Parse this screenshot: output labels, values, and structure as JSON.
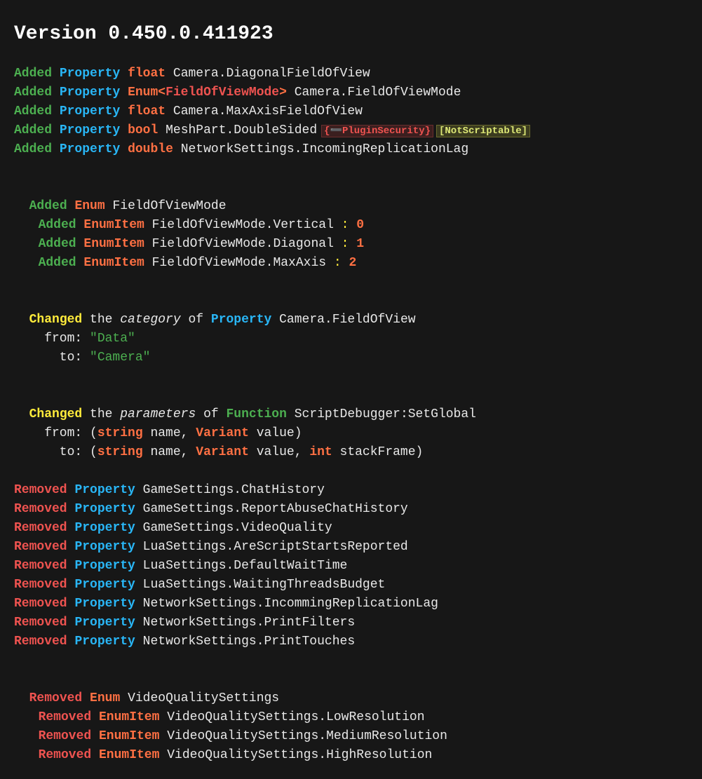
{
  "title": "Version 0.450.0.411923",
  "addedProps": [
    {
      "action": "Added",
      "kind": "Property",
      "type": "float",
      "name": "Camera.DiagonalFieldOfView"
    },
    {
      "action": "Added",
      "kind": "Property",
      "typePrefix": "Enum<",
      "typeInner": "FieldOfViewMode",
      "typeSuffix": ">",
      "name": "Camera.FieldOfViewMode"
    },
    {
      "action": "Added",
      "kind": "Property",
      "type": "float",
      "name": "Camera.MaxAxisFieldOfView"
    },
    {
      "action": "Added",
      "kind": "Property",
      "type": "bool",
      "name": "MeshPart.DoubleSided",
      "tagRed": "{➖PluginSecurity}",
      "tagYellow": "[NotScriptable]"
    },
    {
      "action": "Added",
      "kind": "Property",
      "type": "double",
      "name": "NetworkSettings.IncomingReplicationLag"
    }
  ],
  "addedEnum": {
    "action": "Added",
    "kind": "Enum",
    "name": "FieldOfViewMode",
    "items": [
      {
        "action": "Added",
        "kind": "EnumItem",
        "name": "FieldOfViewMode.Vertical",
        "sep": " : ",
        "value": "0"
      },
      {
        "action": "Added",
        "kind": "EnumItem",
        "name": "FieldOfViewMode.Diagonal",
        "sep": " : ",
        "value": "1"
      },
      {
        "action": "Added",
        "kind": "EnumItem",
        "name": "FieldOfViewMode.MaxAxis",
        "sep": " : ",
        "value": "2"
      }
    ]
  },
  "change1": {
    "action": "Changed",
    "the": " the ",
    "what": "category",
    "of": " of ",
    "kind": "Property",
    "name": " Camera.FieldOfView",
    "fromLabel": "from: ",
    "fromVal": "\"Data\"",
    "toLabel": "to: ",
    "toVal": "\"Camera\""
  },
  "change2": {
    "action": "Changed",
    "the": " the ",
    "what": "parameters",
    "of": " of ",
    "kind": "Function",
    "name": " ScriptDebugger:SetGlobal",
    "fromLabel": "from: ",
    "fromOpen": "(",
    "fromT1": "string",
    "fromN1": " name, ",
    "fromT2": "Variant",
    "fromN2": " value",
    "fromClose": ")",
    "toLabel": "to: ",
    "toOpen": "(",
    "toT1": "string",
    "toN1": " name, ",
    "toT2": "Variant",
    "toN2": " value, ",
    "toT3": "int",
    "toN3": " stackFrame",
    "toClose": ")"
  },
  "removedProps": [
    {
      "action": "Removed",
      "kind": "Property",
      "name": "GameSettings.ChatHistory"
    },
    {
      "action": "Removed",
      "kind": "Property",
      "name": "GameSettings.ReportAbuseChatHistory"
    },
    {
      "action": "Removed",
      "kind": "Property",
      "name": "GameSettings.VideoQuality"
    },
    {
      "action": "Removed",
      "kind": "Property",
      "name": "LuaSettings.AreScriptStartsReported"
    },
    {
      "action": "Removed",
      "kind": "Property",
      "name": "LuaSettings.DefaultWaitTime"
    },
    {
      "action": "Removed",
      "kind": "Property",
      "name": "LuaSettings.WaitingThreadsBudget"
    },
    {
      "action": "Removed",
      "kind": "Property",
      "name": "NetworkSettings.IncommingReplicationLag"
    },
    {
      "action": "Removed",
      "kind": "Property",
      "name": "NetworkSettings.PrintFilters"
    },
    {
      "action": "Removed",
      "kind": "Property",
      "name": "NetworkSettings.PrintTouches"
    }
  ],
  "removedEnum": {
    "action": "Removed",
    "kind": "Enum",
    "name": "VideoQualitySettings",
    "items": [
      {
        "action": "Removed",
        "kind": "EnumItem",
        "name": "VideoQualitySettings.LowResolution"
      },
      {
        "action": "Removed",
        "kind": "EnumItem",
        "name": "VideoQualitySettings.MediumResolution"
      },
      {
        "action": "Removed",
        "kind": "EnumItem",
        "name": "VideoQualitySettings.HighResolution"
      }
    ]
  }
}
